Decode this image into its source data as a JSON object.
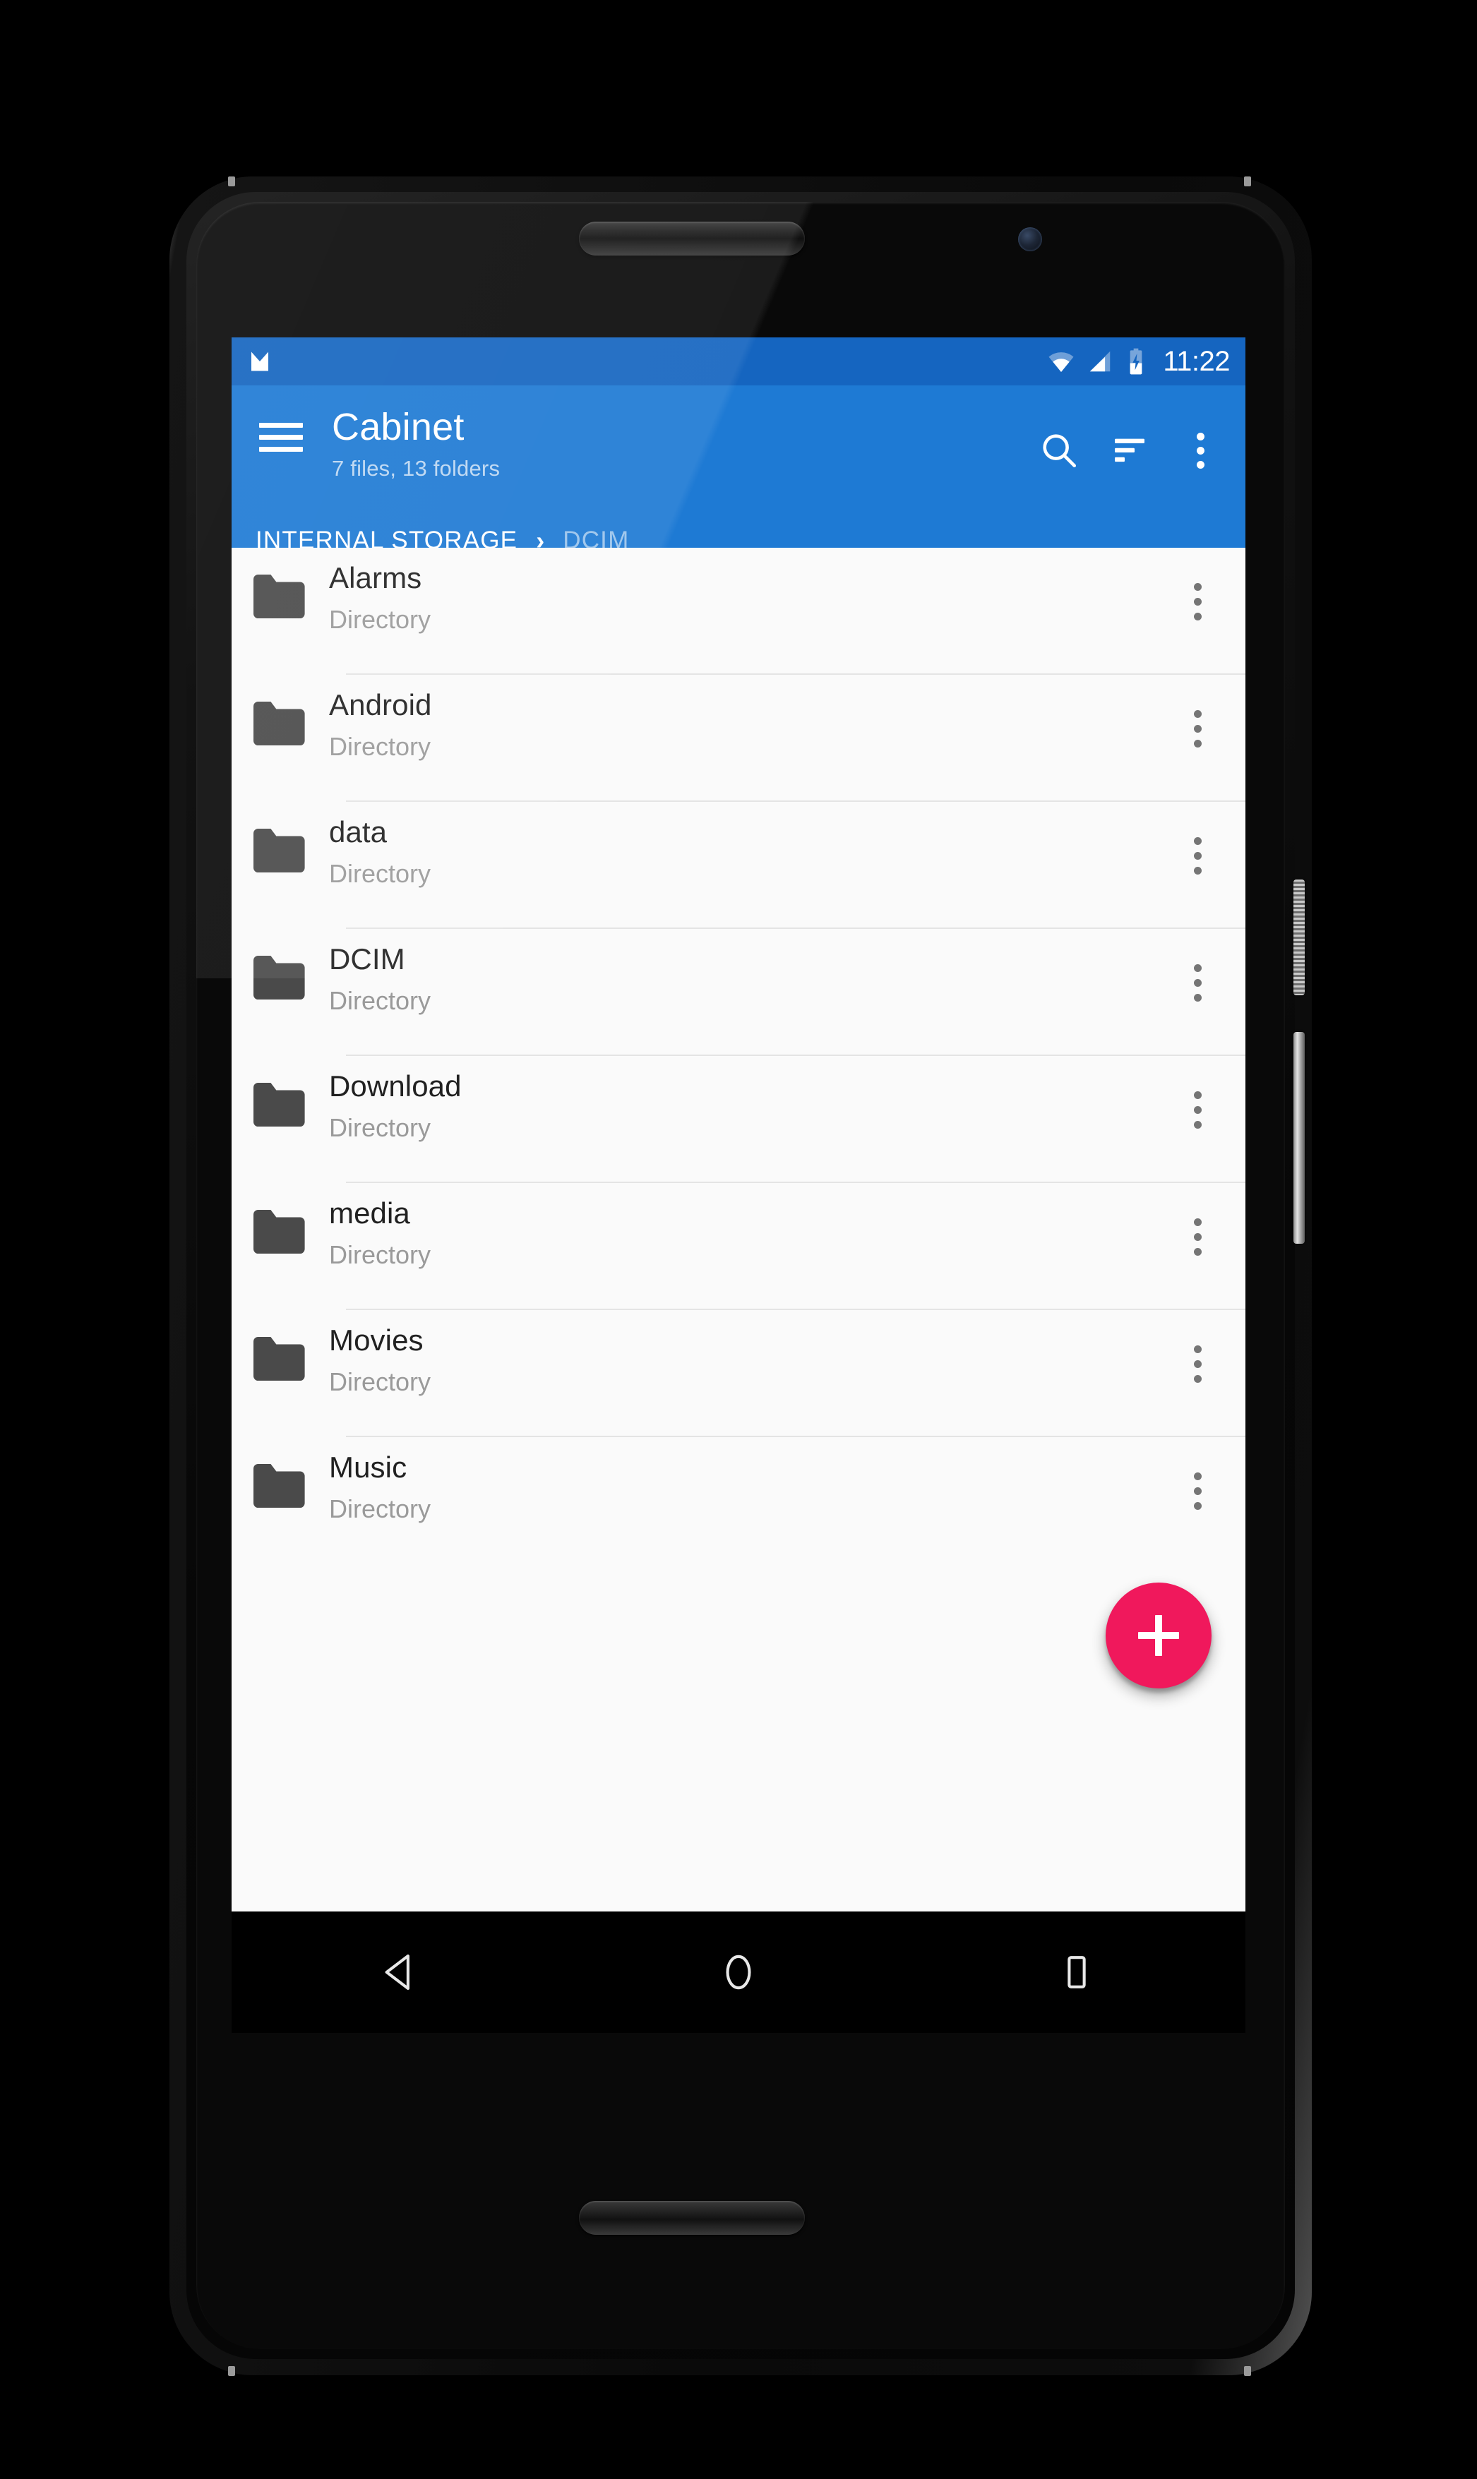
{
  "device": {
    "hardware": {
      "earpiece": "earpiece-speaker",
      "front_camera": "front-camera",
      "bottom_speaker": "bottom-speaker",
      "power_button": "power-button",
      "volume_button": "volume-rocker"
    }
  },
  "status_bar": {
    "notification_icon": "cabinet-app-notification-icon",
    "wifi_icon": "wifi-icon",
    "signal_icon": "cellular-signal-icon",
    "battery_icon": "battery-charging-icon",
    "time": "11:22",
    "background_color": "#1565c0"
  },
  "app_bar": {
    "menu_icon": "hamburger-menu-icon",
    "title": "Cabinet",
    "subtitle": "7 files, 13 folders",
    "background_color": "#1e7ad4",
    "actions": [
      {
        "name": "search",
        "icon": "search-icon"
      },
      {
        "name": "sort",
        "icon": "sort-icon"
      },
      {
        "name": "overflow",
        "icon": "overflow-menu-icon"
      }
    ]
  },
  "breadcrumb": {
    "separator": "›",
    "items": [
      {
        "label": "INTERNAL STORAGE",
        "active": true
      },
      {
        "label": "DCIM",
        "active": false
      }
    ]
  },
  "file_list": {
    "items": [
      {
        "name": "Alarms",
        "subtitle": "Directory",
        "icon": "folder-icon"
      },
      {
        "name": "Android",
        "subtitle": "Directory",
        "icon": "folder-icon"
      },
      {
        "name": "data",
        "subtitle": "Directory",
        "icon": "folder-icon"
      },
      {
        "name": "DCIM",
        "subtitle": "Directory",
        "icon": "folder-icon"
      },
      {
        "name": "Download",
        "subtitle": "Directory",
        "icon": "folder-icon"
      },
      {
        "name": "media",
        "subtitle": "Directory",
        "icon": "folder-icon"
      },
      {
        "name": "Movies",
        "subtitle": "Directory",
        "icon": "folder-icon"
      },
      {
        "name": "Music",
        "subtitle": "Directory",
        "icon": "folder-icon"
      }
    ],
    "row_menu_icon": "overflow-menu-icon",
    "folder_color": "#4a4a4a",
    "background_color": "#fafafa"
  },
  "fab": {
    "icon": "plus-icon",
    "label": "Add",
    "color": "#f0185c"
  },
  "nav_bar": {
    "back": "back-triangle-icon",
    "home": "home-circle-icon",
    "recents": "recents-square-icon",
    "background_color": "#000000"
  }
}
